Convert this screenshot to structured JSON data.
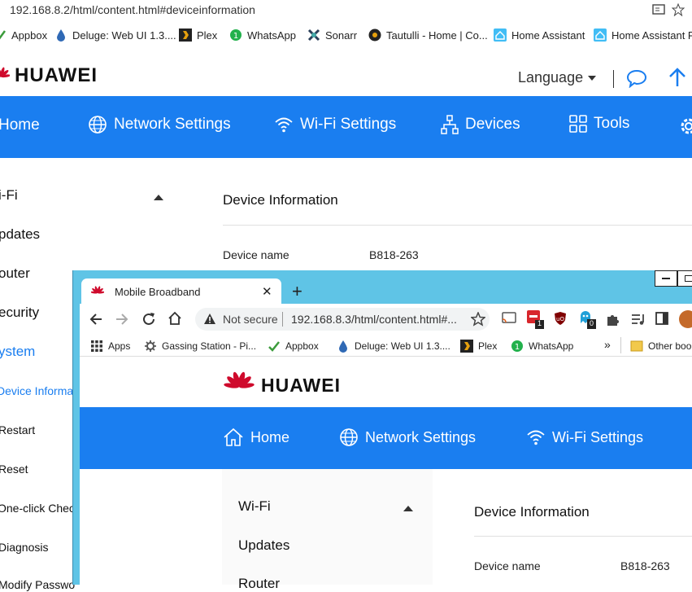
{
  "back": {
    "address": "192.168.8.2/html/content.html#deviceinformation",
    "bookmarks": [
      "Appbox",
      "Deluge: Web UI 1.3....",
      "Plex",
      "WhatsApp",
      "Sonarr",
      "Tautulli - Home | Co...",
      "Home Assistant",
      "Home Assistant Re"
    ],
    "brand": "HUAWEI",
    "language_label": "Language",
    "nav": [
      "Home",
      "Network Settings",
      "Wi-Fi Settings",
      "Devices",
      "Tools"
    ],
    "sidebar": [
      "i-Fi",
      "pdates",
      "outer",
      "ecurity",
      "ystem"
    ],
    "subitems": [
      "Device Informa",
      "Restart",
      "Reset",
      "One-click Chec",
      "Diagnosis",
      "Modify Passwo"
    ],
    "content_title": "Device Information",
    "device_name_label": "Device name",
    "device_name_value": "B818-263"
  },
  "front": {
    "tab_title": "Mobile Broadband",
    "not_secure": "Not secure",
    "address": "192.168.8.3/html/content.html#...",
    "bookmarks": [
      "Apps",
      "Gassing Station - Pi...",
      "Appbox",
      "Deluge: Web UI 1.3....",
      "Plex",
      "WhatsApp",
      "»",
      "Other boo"
    ],
    "badges": {
      "ext1": "1",
      "ext2": "0"
    },
    "brand": "HUAWEI",
    "nav": [
      "Home",
      "Network Settings",
      "Wi-Fi Settings"
    ],
    "sidebar": [
      "Wi-Fi",
      "Updates",
      "Router"
    ],
    "content_title": "Device Information",
    "device_name_label": "Device name",
    "device_name_value": "B818-263"
  },
  "colors": {
    "accent": "#1a7ef0",
    "huawei_red": "#cf0a2c",
    "frame": "#5fc4e6"
  }
}
